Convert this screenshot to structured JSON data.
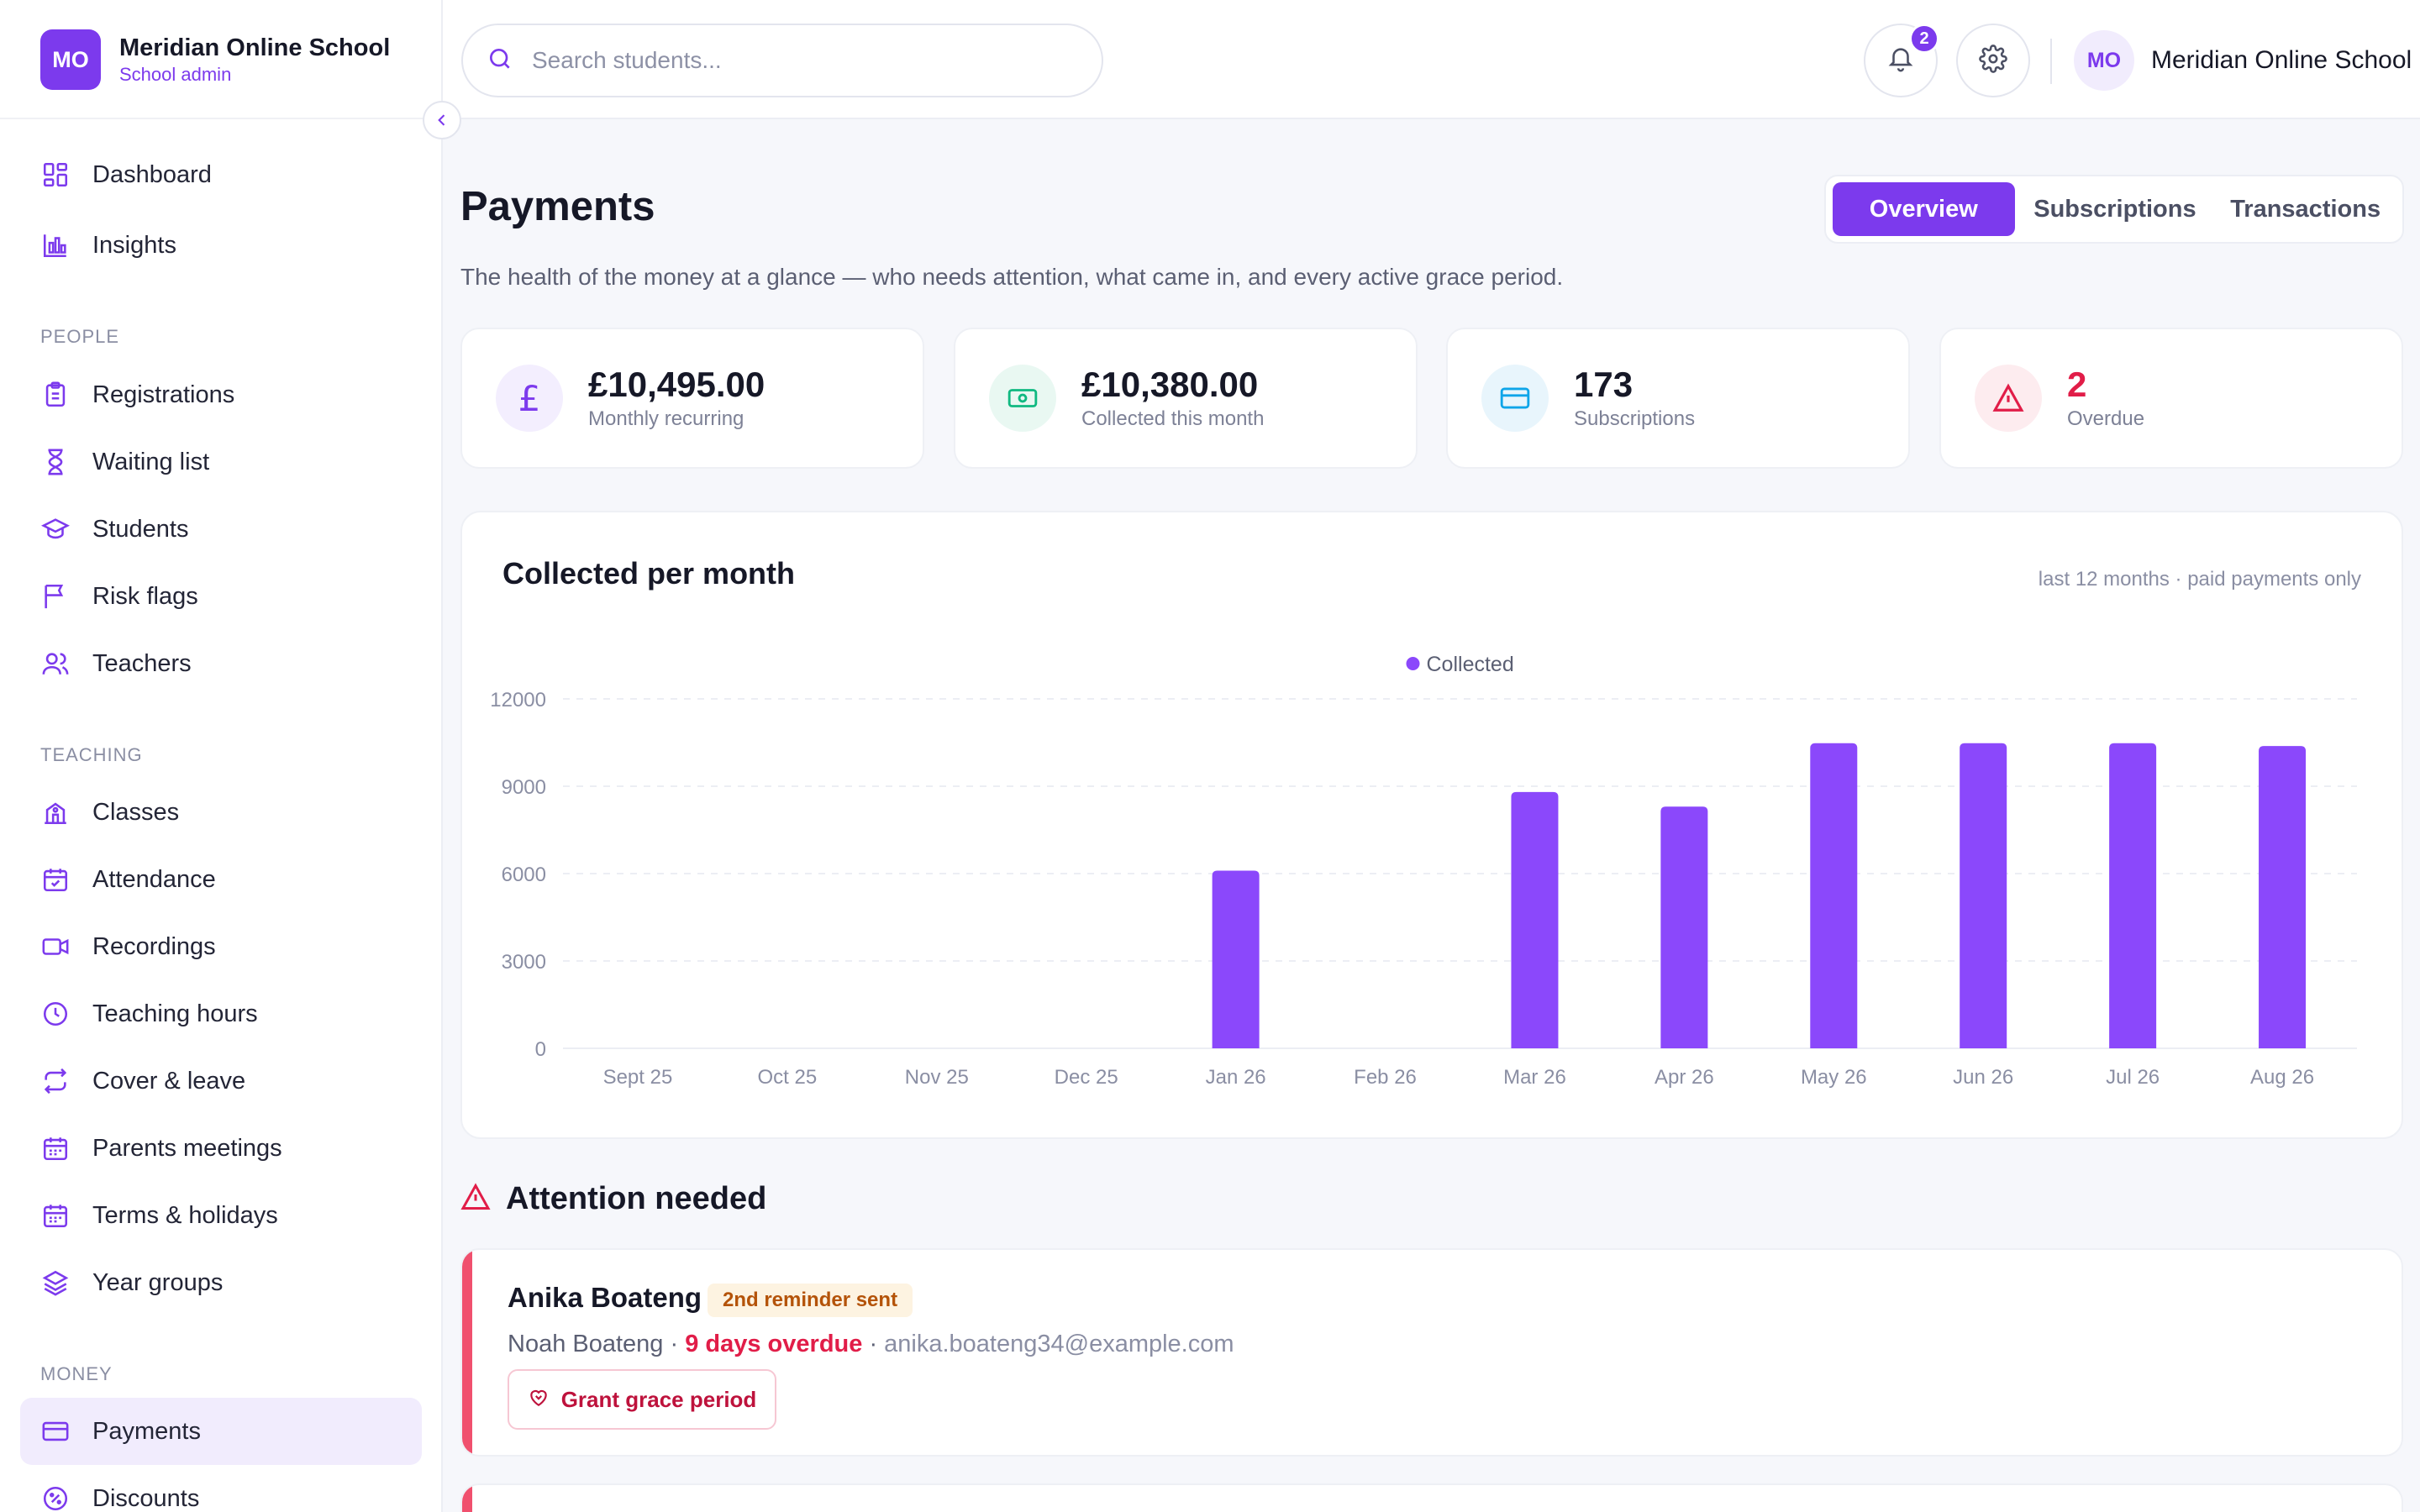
{
  "brand": {
    "initials": "MO",
    "name": "Meridian Online School",
    "role": "School admin"
  },
  "nav": {
    "top": [
      {
        "label": "Dashboard",
        "icon": "dashboard-icon"
      },
      {
        "label": "Insights",
        "icon": "bar-chart-icon"
      }
    ],
    "people_title": "PEOPLE",
    "people": [
      {
        "label": "Registrations",
        "icon": "clipboard-icon"
      },
      {
        "label": "Waiting list",
        "icon": "hourglass-icon"
      },
      {
        "label": "Students",
        "icon": "graduation-cap-icon"
      },
      {
        "label": "Risk flags",
        "icon": "flag-icon"
      },
      {
        "label": "Teachers",
        "icon": "users-icon"
      }
    ],
    "teaching_title": "TEACHING",
    "teaching": [
      {
        "label": "Classes",
        "icon": "school-icon"
      },
      {
        "label": "Attendance",
        "icon": "calendar-check-icon"
      },
      {
        "label": "Recordings",
        "icon": "video-icon"
      },
      {
        "label": "Teaching hours",
        "icon": "clock-icon"
      },
      {
        "label": "Cover & leave",
        "icon": "swap-icon"
      },
      {
        "label": "Parents meetings",
        "icon": "calendar-icon"
      },
      {
        "label": "Terms & holidays",
        "icon": "calendar-icon"
      },
      {
        "label": "Year groups",
        "icon": "layers-icon"
      }
    ],
    "money_title": "MONEY",
    "money": [
      {
        "label": "Payments",
        "icon": "credit-card-icon",
        "active": true
      },
      {
        "label": "Discounts",
        "icon": "discount-icon"
      }
    ]
  },
  "topbar": {
    "search_placeholder": "Search students...",
    "notification_count": "2",
    "user_initials": "MO",
    "user_name": "Meridian Online School"
  },
  "page": {
    "title": "Payments",
    "subtitle": "The health of the money at a glance — who needs attention, what came in, and every active grace period.",
    "tabs": [
      "Overview",
      "Subscriptions",
      "Transactions"
    ],
    "active_tab": "Overview"
  },
  "kpis": [
    {
      "value": "£10,495.00",
      "label": "Monthly recurring",
      "icon": "pound-icon",
      "color": "#7c3aed"
    },
    {
      "value": "£10,380.00",
      "label": "Collected this month",
      "icon": "banknote-icon",
      "color": "#10b981"
    },
    {
      "value": "173",
      "label": "Subscriptions",
      "icon": "credit-card-icon",
      "color": "#0ea5e9"
    },
    {
      "value": "2",
      "label": "Overdue",
      "icon": "warning-icon",
      "color": "#e11d48"
    }
  ],
  "chart_card": {
    "title": "Collected per month",
    "note": "last 12 months · paid payments only"
  },
  "chart_data": {
    "type": "bar",
    "categories": [
      "Sept 25",
      "Oct 25",
      "Nov 25",
      "Dec 25",
      "Jan 26",
      "Feb 26",
      "Mar 26",
      "Apr 26",
      "May 26",
      "Jun 26",
      "Jul 26",
      "Aug 26"
    ],
    "series": [
      {
        "name": "Collected",
        "values": [
          0,
          0,
          0,
          0,
          6100,
          0,
          8800,
          8300,
          10480,
          10480,
          10480,
          10380
        ]
      }
    ],
    "yticks": [
      0,
      3000,
      6000,
      9000,
      12000
    ],
    "ylim": [
      0,
      12000
    ],
    "grid": true,
    "legend_position": "top-center",
    "bar_color": "#8b48fb"
  },
  "attention": {
    "title": "Attention needed",
    "items": [
      {
        "name": "Anika Boateng",
        "badge": "2nd reminder sent",
        "student": "Noah Boateng",
        "overdue": "9 days overdue",
        "email": "anika.boateng34@example.com",
        "action": "Grant grace period"
      }
    ]
  },
  "colors": {
    "accent": "#7c3aed",
    "danger": "#e11d48",
    "success": "#10b981",
    "info": "#0ea5e9"
  }
}
